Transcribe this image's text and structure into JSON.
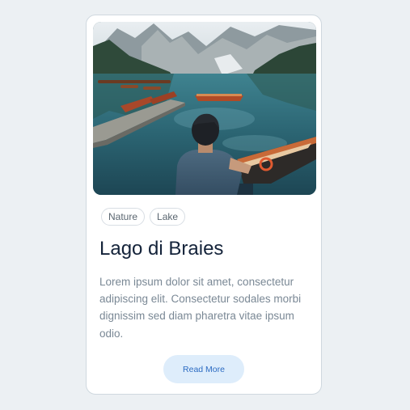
{
  "card": {
    "image_alt": "Man sitting on a wooden dock overlooking a mountain lake with rowboats",
    "tags": [
      "Nature",
      "Lake"
    ],
    "title": "Lago di Braies",
    "description": "Lorem ipsum dolor sit amet, consectetur adipiscing elit. Consectetur sodales morbi dignissim sed diam pharetra vitae ipsum odio.",
    "button_label": "Read More"
  },
  "colors": {
    "page_background": "#ecf0f3",
    "card_background": "#ffffff",
    "title": "#14233a",
    "description": "#7a8895",
    "button_background": "#deedfb",
    "button_text": "#2c6bc2"
  }
}
